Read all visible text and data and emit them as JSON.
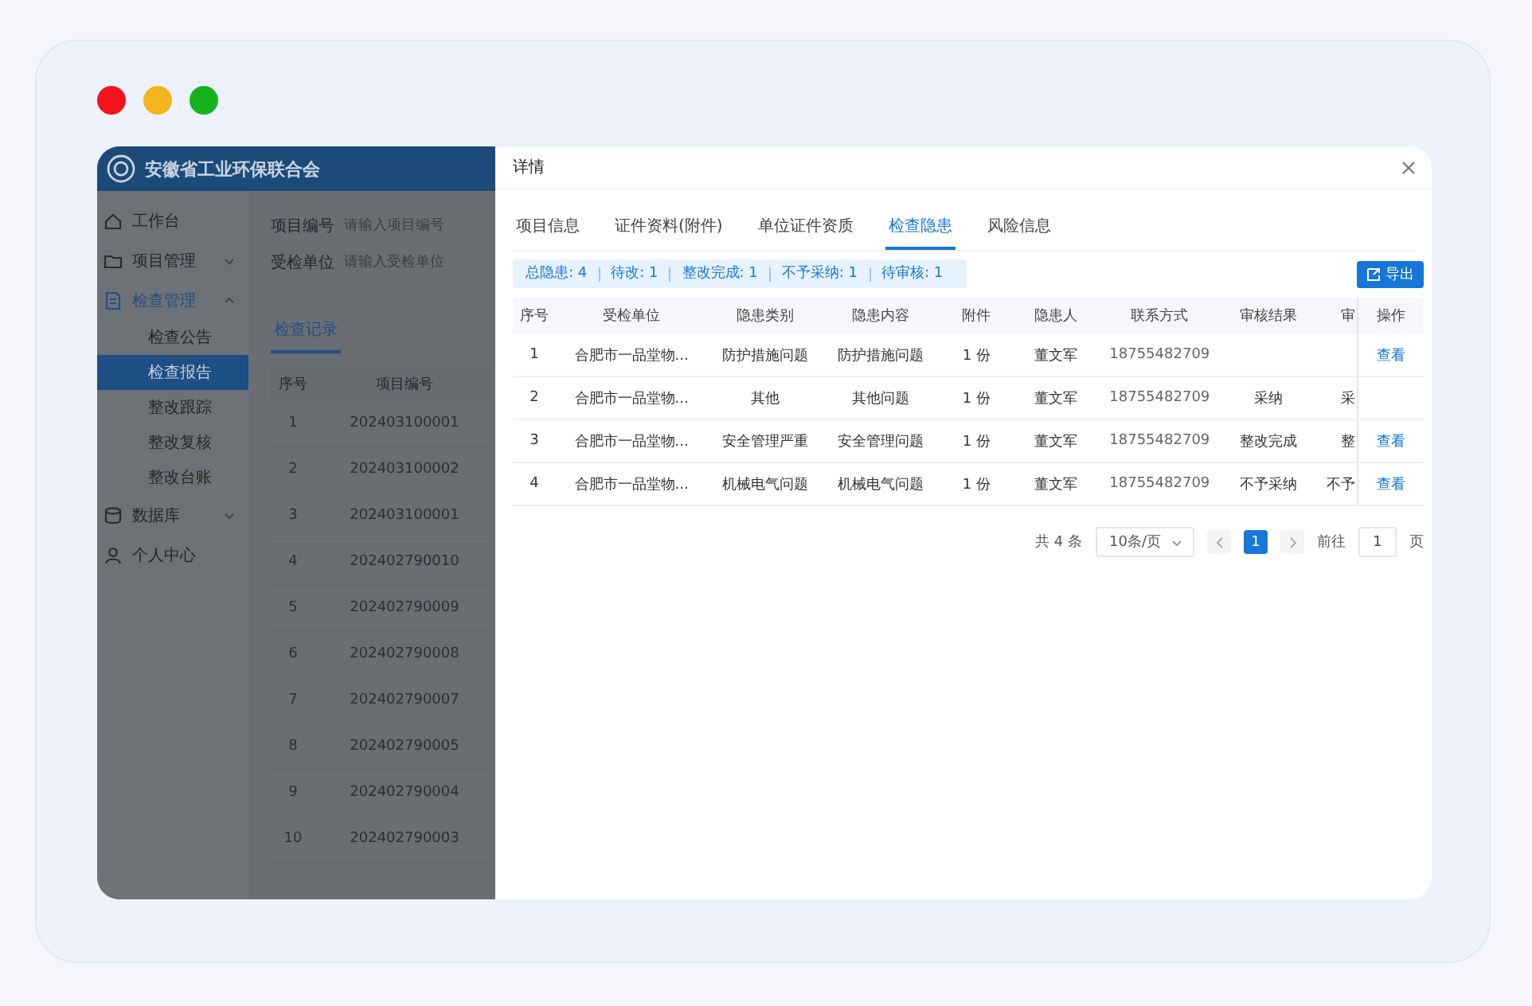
{
  "app": {
    "title": "安徽省工业环保联合会"
  },
  "sidebar": {
    "items": [
      {
        "label": "工作台",
        "selected": false
      },
      {
        "label": "项目管理",
        "selected": false,
        "expanded": false
      },
      {
        "label": "检查管理",
        "selected": true,
        "expanded": true,
        "children": [
          {
            "label": "检查公告",
            "selected": false
          },
          {
            "label": "检查报告",
            "selected": true
          },
          {
            "label": "整改跟踪",
            "selected": false
          },
          {
            "label": "整改复核",
            "selected": false
          },
          {
            "label": "整改台账",
            "selected": false
          }
        ]
      },
      {
        "label": "数据库",
        "selected": false,
        "expanded": false
      },
      {
        "label": "个人中心",
        "selected": false
      }
    ]
  },
  "records": {
    "filters": [
      {
        "label": "项目编号",
        "placeholder": "请输入项目编号"
      },
      {
        "label": "受检单位",
        "placeholder": "请输入受检单位"
      }
    ],
    "tabs": [
      {
        "label": "检查记录",
        "selected": true
      }
    ],
    "table": {
      "columns": [
        "序号",
        "项目编号"
      ],
      "rows": [
        [
          "1",
          "202403100001"
        ],
        [
          "2",
          "202403100002"
        ],
        [
          "3",
          "202403100001"
        ],
        [
          "4",
          "202402790010"
        ],
        [
          "5",
          "202402790009"
        ],
        [
          "6",
          "202402790008"
        ],
        [
          "7",
          "202402790007"
        ],
        [
          "8",
          "202402790005"
        ],
        [
          "9",
          "202402790004"
        ],
        [
          "10",
          "202402790003"
        ]
      ]
    }
  },
  "drawer": {
    "title": "详情",
    "tabs": [
      {
        "label": "项目信息",
        "selected": false
      },
      {
        "label": "证件资料(附件)",
        "selected": false
      },
      {
        "label": "单位证件资质",
        "selected": false
      },
      {
        "label": "检查隐患",
        "selected": true
      },
      {
        "label": "风险信息",
        "selected": false
      }
    ],
    "summary": [
      "总隐患: 4",
      "待改: 1",
      "整改完成: 1",
      "不予采纳: 1",
      "待审核: 1"
    ],
    "export_button": "导出",
    "table": {
      "columns": [
        "序号",
        "受检单位",
        "隐患类别",
        "隐患内容",
        "附件",
        "隐患人",
        "联系方式",
        "审核结果",
        "审",
        "操作"
      ],
      "rows": [
        {
          "index": "1",
          "unit": "合肥市一品堂物...",
          "category": "防护措施问题",
          "content": "防护措施问题",
          "attachment": "1 份",
          "person": "董文军",
          "phone": "18755482709",
          "action": "查看"
        },
        {
          "index": "2",
          "unit": "合肥市一品堂物...",
          "category": "其他",
          "content": "其他问题",
          "attachment": "1 份",
          "person": "董文军",
          "phone": "18755482709",
          "review_result": "采纳",
          "column_9": "采"
        },
        {
          "index": "3",
          "unit": "合肥市一品堂物...",
          "category": "安全管理严重",
          "content": "安全管理问题",
          "attachment": "1 份",
          "person": "董文军",
          "phone": "18755482709",
          "review_result": "整改完成",
          "column_9": "整",
          "action": "查看"
        },
        {
          "index": "4",
          "unit": "合肥市一品堂物...",
          "category": "机械电气问题",
          "content": "机械电气问题",
          "attachment": "1 份",
          "person": "董文军",
          "phone": "18755482709",
          "review_result": "不予采纳",
          "column_9": "不予",
          "action": "查看"
        }
      ]
    },
    "pagination": {
      "total": "共 4 条",
      "page_size": "10条/页",
      "pages": [
        {
          "label": "1",
          "selected": true
        }
      ],
      "jump_label": "前往",
      "jump_value": "1",
      "jump_suffix": "页"
    }
  }
}
